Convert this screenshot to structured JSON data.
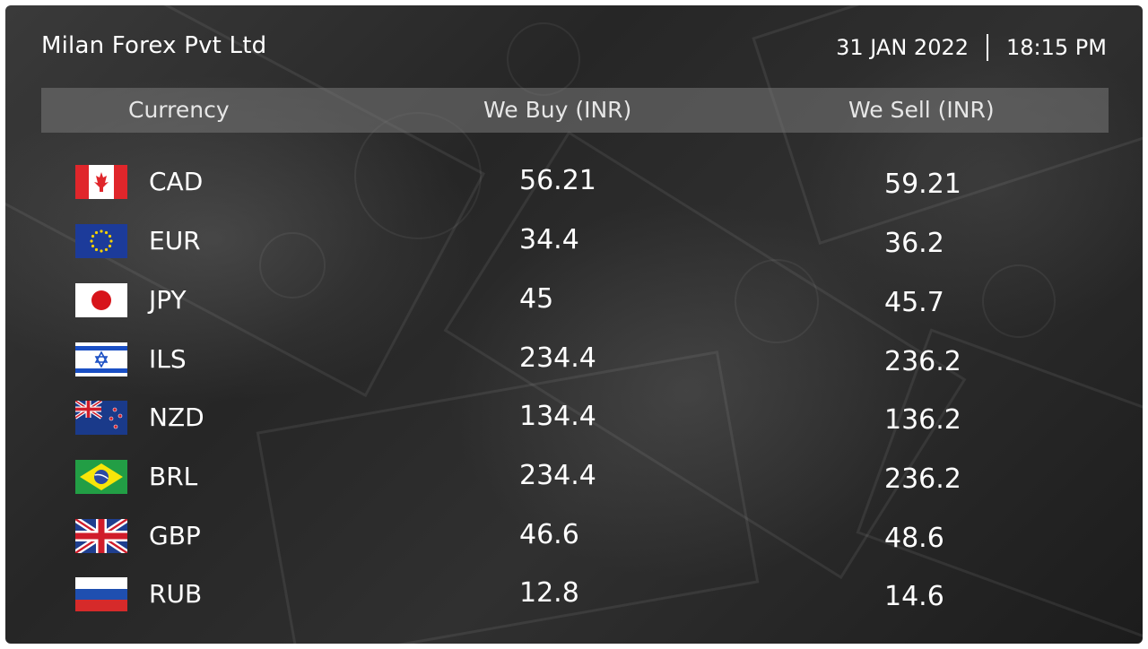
{
  "brand": {
    "name": "Milan Forex Pvt Ltd"
  },
  "datetime": {
    "date": "31 JAN 2022",
    "time": "18:15 PM"
  },
  "table": {
    "headers": {
      "currency": "Currency",
      "buy": "We Buy (INR)",
      "sell": "We Sell (INR)"
    },
    "rows": [
      {
        "flag": "canada-flag-icon",
        "code": "CAD",
        "buy": "56.21",
        "sell": "59.21"
      },
      {
        "flag": "eu-flag-icon",
        "code": "EUR",
        "buy": "34.4",
        "sell": "36.2"
      },
      {
        "flag": "japan-flag-icon",
        "code": "JPY",
        "buy": "45",
        "sell": "45.7"
      },
      {
        "flag": "israel-flag-icon",
        "code": "ILS",
        "buy": "234.4",
        "sell": "236.2"
      },
      {
        "flag": "new-zealand-flag-icon",
        "code": "NZD",
        "buy": "134.4",
        "sell": "136.2"
      },
      {
        "flag": "brazil-flag-icon",
        "code": "BRL",
        "buy": "234.4",
        "sell": "236.2"
      },
      {
        "flag": "uk-flag-icon",
        "code": "GBP",
        "buy": "46.6",
        "sell": "48.6"
      },
      {
        "flag": "russia-flag-icon",
        "code": "RUB",
        "buy": "12.8",
        "sell": "14.6"
      }
    ]
  },
  "colors": {
    "text": "#ffffff",
    "header_bar": "#787878",
    "background": "#2a2a2a"
  }
}
